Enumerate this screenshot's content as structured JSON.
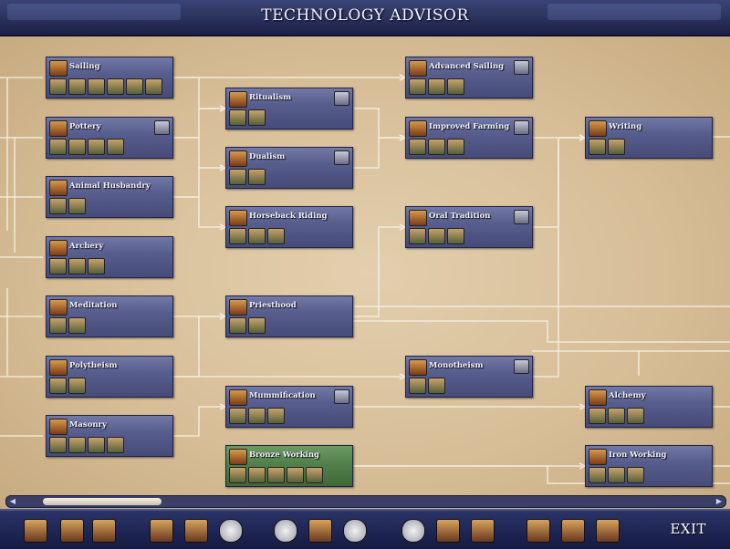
{
  "header": {
    "title": "TECHNOLOGY ADVISOR"
  },
  "techs": [
    {
      "name": "Sailing",
      "unlocks": 6,
      "green": false,
      "corner": false
    },
    {
      "name": "Pottery",
      "unlocks": 4,
      "green": false,
      "corner": true
    },
    {
      "name": "Animal Husbandry",
      "unlocks": 2,
      "green": false,
      "corner": false
    },
    {
      "name": "Archery",
      "unlocks": 3,
      "green": false,
      "corner": false
    },
    {
      "name": "Meditation",
      "unlocks": 2,
      "green": false,
      "corner": false
    },
    {
      "name": "Polytheism",
      "unlocks": 2,
      "green": false,
      "corner": false
    },
    {
      "name": "Masonry",
      "unlocks": 4,
      "green": false,
      "corner": false
    },
    {
      "name": "Ritualism",
      "unlocks": 2,
      "green": false,
      "corner": true
    },
    {
      "name": "Dualism",
      "unlocks": 2,
      "green": false,
      "corner": true
    },
    {
      "name": "Horseback Riding",
      "unlocks": 3,
      "green": false,
      "corner": false
    },
    {
      "name": "Priesthood",
      "unlocks": 2,
      "green": false,
      "corner": false
    },
    {
      "name": "Mummification",
      "unlocks": 3,
      "green": false,
      "corner": true
    },
    {
      "name": "Bronze Working",
      "unlocks": 5,
      "green": true,
      "corner": false
    },
    {
      "name": "Advanced Sailing",
      "unlocks": 3,
      "green": false,
      "corner": true
    },
    {
      "name": "Improved Farming",
      "unlocks": 3,
      "green": false,
      "corner": true
    },
    {
      "name": "Oral Tradition",
      "unlocks": 3,
      "green": false,
      "corner": true
    },
    {
      "name": "Monotheism",
      "unlocks": 2,
      "green": false,
      "corner": true
    },
    {
      "name": "Writing",
      "unlocks": 2,
      "green": false,
      "corner": false
    },
    {
      "name": "Alchemy",
      "unlocks": 3,
      "green": false,
      "corner": false
    },
    {
      "name": "Iron Working",
      "unlocks": 3,
      "green": false,
      "corner": false
    }
  ],
  "bottombar": {
    "exit_label": "EXIT",
    "icons": [
      "advisor-icon",
      "advisor-icon",
      "advisor-icon",
      "advisor-icon",
      "wonder-icon",
      "disc-icon",
      "disc-icon",
      "advisor-icon",
      "disc-icon",
      "disc-icon",
      "advisor-icon",
      "advisor-icon",
      "advisor-icon",
      "advisor-icon",
      "advisor-icon",
      "advisor-icon"
    ]
  },
  "colors": {
    "card": "#575d8d",
    "card_researching": "#52804a",
    "parchment": "#d6bd96",
    "bar": "#1c2146"
  }
}
